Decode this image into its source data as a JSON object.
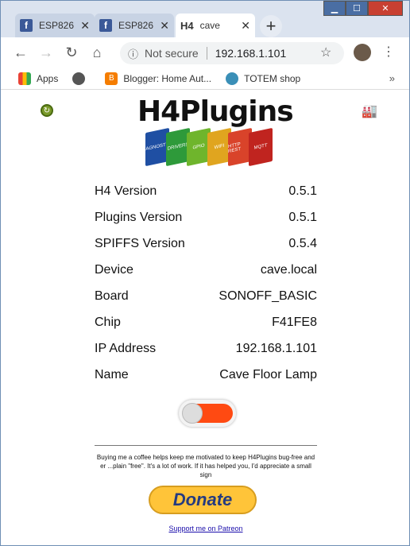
{
  "tabs": [
    {
      "label": "ESP826",
      "icon": "facebook-icon"
    },
    {
      "label": "ESP826",
      "icon": "facebook-icon"
    },
    {
      "label": "cave",
      "prefix": "H4"
    }
  ],
  "address": {
    "security": "Not secure",
    "url": "192.168.1.101"
  },
  "bookmarks": [
    {
      "label": "Apps"
    },
    {
      "label": ""
    },
    {
      "label": "Blogger: Home Aut..."
    },
    {
      "label": "TOTEM shop"
    }
  ],
  "logo": {
    "title": "H4Plugins",
    "blocks": [
      "DIAGNOSTICS",
      "DRIVERS",
      "GPIO",
      "WIFI",
      "HTTP REST",
      "MQTT"
    ]
  },
  "info": [
    {
      "label": "H4 Version",
      "value": "0.5.1"
    },
    {
      "label": "Plugins Version",
      "value": "0.5.1"
    },
    {
      "label": "SPIFFS Version",
      "value": "0.5.4"
    },
    {
      "label": "Device",
      "value": "cave.local"
    },
    {
      "label": "Board",
      "value": "SONOFF_BASIC"
    },
    {
      "label": "Chip",
      "value": "F41FE8"
    },
    {
      "label": "IP Address",
      "value": "192.168.1.101"
    },
    {
      "label": "Name",
      "value": "Cave Floor Lamp"
    }
  ],
  "switch": {
    "state": "on"
  },
  "coffee_text": "Buying me a coffee helps keep me motivated to keep H4Plugins bug-free and er ...plain \"free\". It's a lot of work. If it has helped you, I'd appreciate a small sign",
  "donate_label": "Donate",
  "patreon_label": "Support me on Patreon",
  "colors": {
    "toggle_on": "#ff4a12",
    "donate_bg": "#ffc439",
    "donate_text": "#253b80"
  }
}
